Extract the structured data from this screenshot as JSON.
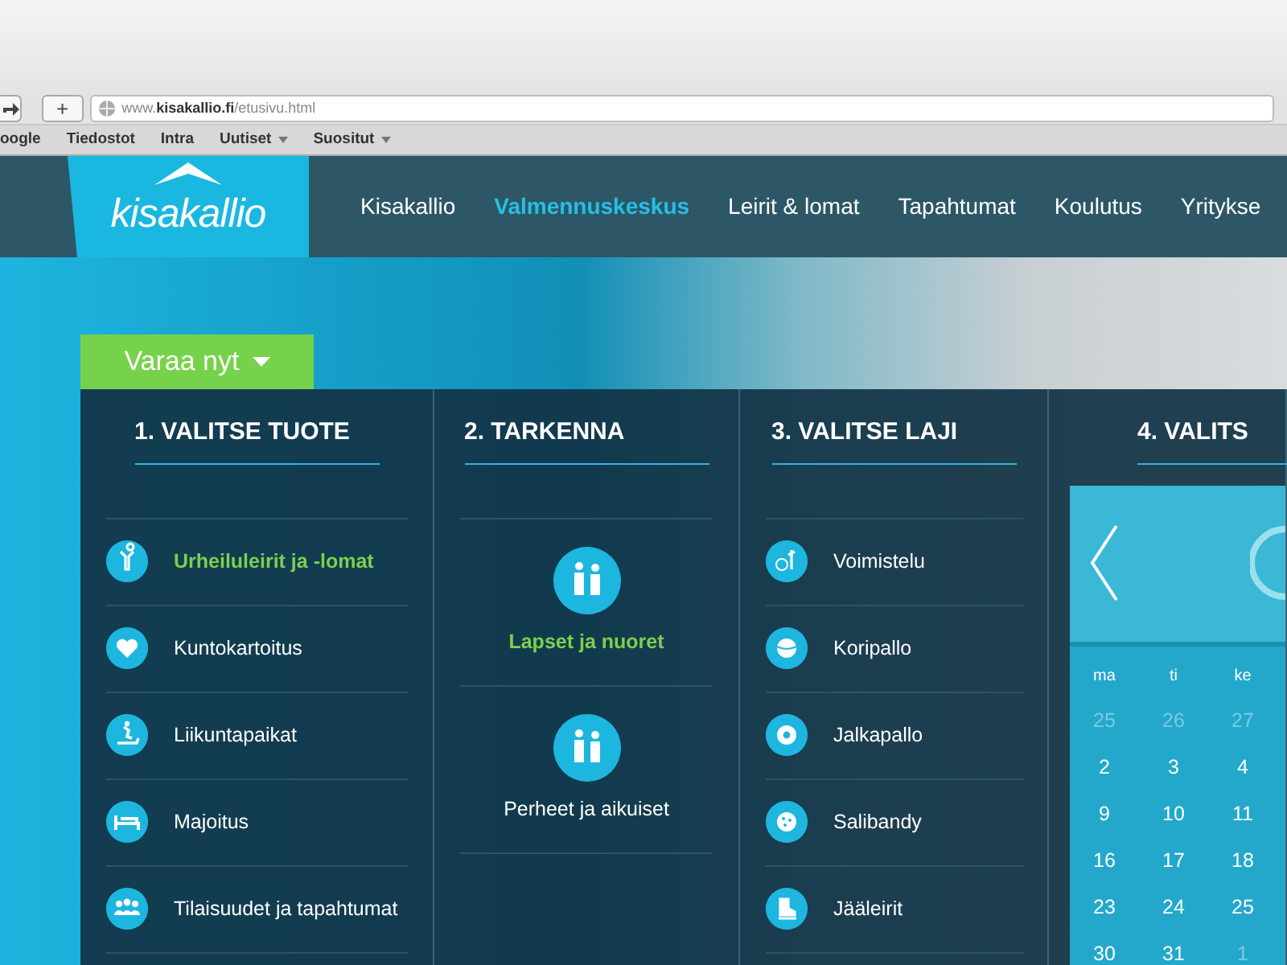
{
  "browser": {
    "address": {
      "domain": "www.",
      "host": "kisakallio.fi",
      "path": "/etusivu.html"
    },
    "add_tab": "+",
    "bookmarks": [
      {
        "label": "oogle",
        "menu": false
      },
      {
        "label": "Tiedostot",
        "menu": false
      },
      {
        "label": "Intra",
        "menu": false
      },
      {
        "label": "Uutiset",
        "menu": true
      },
      {
        "label": "Suositut",
        "menu": true
      }
    ]
  },
  "site": {
    "logo": "kisakallio",
    "nav": [
      {
        "label": "Kisakallio",
        "selected": false
      },
      {
        "label": "Valmennuskeskus",
        "selected": true
      },
      {
        "label": "Leirit & lomat",
        "selected": false
      },
      {
        "label": "Tapahtumat",
        "selected": false
      },
      {
        "label": "Koulutus",
        "selected": false
      },
      {
        "label": "Yritykse",
        "selected": false
      }
    ]
  },
  "booking": {
    "button": "Varaa nyt",
    "steps": [
      {
        "title": "1. VALITSE TUOTE",
        "kind": "list",
        "items": [
          {
            "label": "Urheiluleirit  ja -lomat",
            "selected": true
          },
          {
            "label": "Kuntokartoitus",
            "selected": false
          },
          {
            "label": "Liikuntapaikat",
            "selected": false
          },
          {
            "label": "Majoitus",
            "selected": false
          },
          {
            "label": "Tilaisuudet ja tapahtumat",
            "selected": false
          }
        ]
      },
      {
        "title": "2. TARKENNA",
        "kind": "tiles",
        "items": [
          {
            "label": "Lapset ja nuoret",
            "selected": true
          },
          {
            "label": "Perheet ja aikuiset",
            "selected": false
          }
        ]
      },
      {
        "title": "3. VALITSE LAJI",
        "kind": "list",
        "items": [
          {
            "label": "Voimistelu",
            "selected": false
          },
          {
            "label": "Koripallo",
            "selected": false
          },
          {
            "label": "Jalkapallo",
            "selected": false
          },
          {
            "label": "Salibandy",
            "selected": false
          },
          {
            "label": "Jääleirit",
            "selected": false
          }
        ]
      },
      {
        "title": "4. VALITS",
        "kind": "calendar"
      }
    ],
    "calendar": {
      "weekdays": [
        "ma",
        "ti",
        "ke"
      ],
      "weeks": [
        [
          {
            "day": "25",
            "other_month": true
          },
          {
            "day": "26",
            "other_month": true
          },
          {
            "day": "27",
            "other_month": true
          }
        ],
        [
          {
            "day": "2",
            "other_month": false
          },
          {
            "day": "3",
            "other_month": false
          },
          {
            "day": "4",
            "other_month": false
          }
        ],
        [
          {
            "day": "9",
            "other_month": false
          },
          {
            "day": "10",
            "other_month": false
          },
          {
            "day": "11",
            "other_month": false
          }
        ],
        [
          {
            "day": "16",
            "other_month": false
          },
          {
            "day": "17",
            "other_month": false
          },
          {
            "day": "18",
            "other_month": false
          }
        ],
        [
          {
            "day": "23",
            "other_month": false
          },
          {
            "day": "24",
            "other_month": false
          },
          {
            "day": "25",
            "other_month": false
          }
        ],
        [
          {
            "day": "30",
            "other_month": false
          },
          {
            "day": "31",
            "other_month": false
          },
          {
            "day": "1",
            "other_month": true
          }
        ]
      ]
    }
  }
}
